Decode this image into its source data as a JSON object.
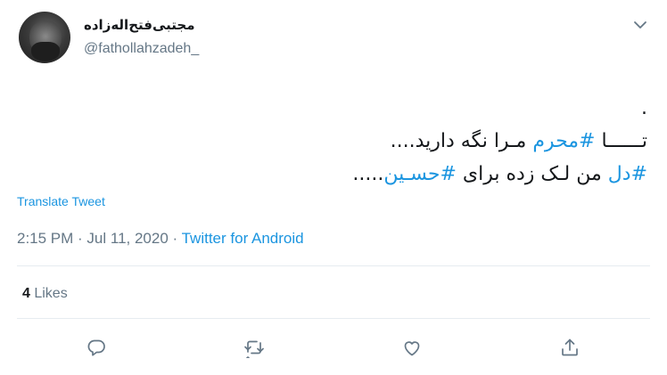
{
  "author": {
    "display_name": "مجتبی‌فتح‌اله‌زاده",
    "handle": "@fathollahzadeh_",
    "avatar_icon": "user-avatar-photo"
  },
  "tweet": {
    "dot": ".",
    "line2": {
      "prefix": "تــــــا ",
      "hashtag": "#محرم",
      "suffix": " مـرا نگه دارید...."
    },
    "line3": {
      "hashtag1": "#دل",
      "middle": " من لـک زده برای ",
      "hashtag2": "#حسـین",
      "suffix": "....."
    }
  },
  "translate_label": "Translate Tweet",
  "meta": {
    "time": "2:15 PM",
    "separator1": " · ",
    "date": "Jul 11, 2020",
    "separator2": " · ",
    "source": "Twitter for Android"
  },
  "engagement": {
    "likes_count": "4",
    "likes_label": " Likes"
  },
  "actions": {
    "reply_icon": "reply-icon",
    "retweet_icon": "retweet-icon",
    "like_icon": "heart-icon",
    "share_icon": "share-icon"
  },
  "colors": {
    "text": "#14171a",
    "secondary": "#657786",
    "link": "#1b95e0",
    "divider": "#e6ecf0"
  }
}
